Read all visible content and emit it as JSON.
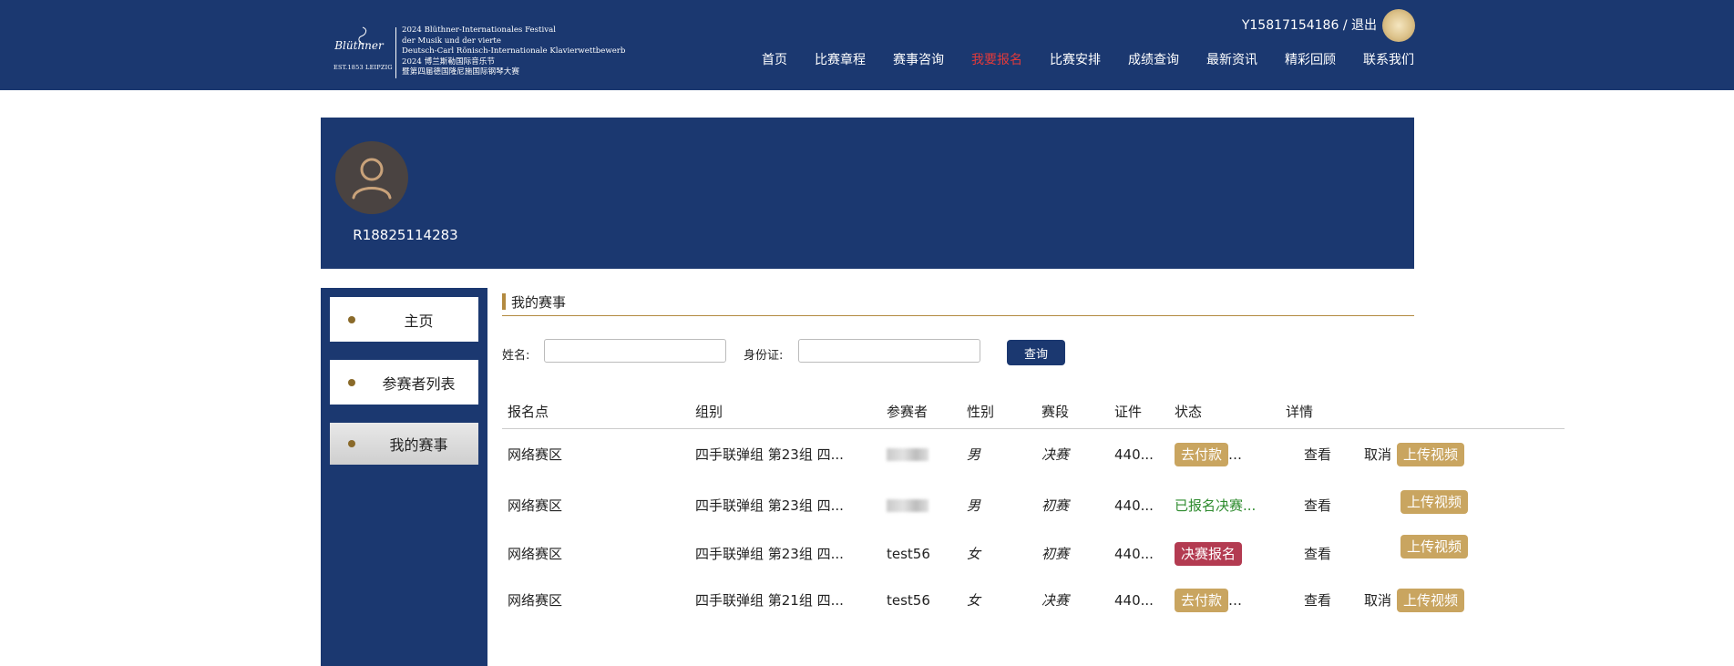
{
  "header": {
    "logo": {
      "script": "Blüthner",
      "est": "EST.1853 LEIPZIG",
      "lines": [
        "2024 Blüthner-Internationales Festival",
        "der Musik und der vierte",
        "Deutsch-Carl Rönisch-Internationale Klavierwettbewerb",
        "2024 博兰斯勒国际音乐节",
        "暨第四届德国隆尼施国际钢琴大赛"
      ]
    },
    "user_id": "Y15817154186",
    "separator": "/",
    "logout": "退出",
    "nav": [
      "首页",
      "比赛章程",
      "赛事咨询",
      "我要报名",
      "比赛安排",
      "成绩查询",
      "最新资讯",
      "精彩回顾",
      "联系我们"
    ],
    "active_nav": "我要报名"
  },
  "profile": {
    "id": "R18825114283"
  },
  "sidebar": {
    "items": [
      "主页",
      "参赛者列表",
      "我的赛事"
    ],
    "active": "我的赛事"
  },
  "main": {
    "section_title": "我的赛事",
    "search": {
      "name_label": "姓名:",
      "name_value": "",
      "id_label": "身份证:",
      "id_value": "",
      "button": "查询"
    },
    "table": {
      "headers": [
        "报名点",
        "组别",
        "参赛者",
        "性别",
        "赛段",
        "证件",
        "状态",
        "详情"
      ],
      "rows": [
        {
          "venue": "网络赛区",
          "group": "四手联弹组 第23组 四...",
          "player": "",
          "gender": "男",
          "stage": "决赛",
          "cert": "440...",
          "status": "去付款",
          "status_type": "pay",
          "detail": "查看",
          "cancel": "取消",
          "upload": "上传视频"
        },
        {
          "venue": "网络赛区",
          "group": "四手联弹组 第23组 四...",
          "player": "",
          "gender": "男",
          "stage": "初赛",
          "cert": "440...",
          "status": "已报名决赛...",
          "status_type": "green",
          "detail": "查看",
          "cancel": "",
          "upload": "上传视频"
        },
        {
          "venue": "网络赛区",
          "group": "四手联弹组 第23组 四...",
          "player": "test56",
          "gender": "女",
          "stage": "初赛",
          "cert": "440...",
          "status": "决赛报名",
          "status_type": "final",
          "detail": "查看",
          "cancel": "",
          "upload": "上传视频"
        },
        {
          "venue": "网络赛区",
          "group": "四手联弹组 第21组 四...",
          "player": "test56",
          "gender": "女",
          "stage": "决赛",
          "cert": "440...",
          "status": "去付款",
          "status_type": "pay",
          "detail": "查看",
          "cancel": "取消",
          "upload": "上传视频"
        }
      ]
    }
  },
  "colors": {
    "primary": "#1b3870",
    "accent_gold": "#c9a560",
    "active_nav": "#e23a3a",
    "final_badge": "#b33b51",
    "status_green": "#2e8b2e"
  }
}
